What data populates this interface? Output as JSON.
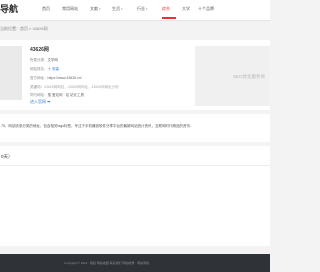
{
  "header": {
    "logo_text": "导航",
    "nav": [
      {
        "label": "首页"
      },
      {
        "label": "常用网站"
      },
      {
        "label": "文献"
      },
      {
        "label": "生活"
      },
      {
        "label": "行业"
      },
      {
        "label": "综合"
      },
      {
        "label": "大学"
      },
      {
        "label": "十个品牌"
      }
    ],
    "active_index": 4
  },
  "breadcrumb": "当前位置：首页 » 43626网",
  "site": {
    "name": "43626网",
    "rows": [
      {
        "label": "所属分类：",
        "value": "文学网"
      },
      {
        "label": "网站排名：",
        "value": "十 安装"
      },
      {
        "label": "官方网址：",
        "value": "https://www.43626.cn/"
      },
      {
        "label": "关键词：",
        "value": "43626网网站，43626网网址，43626网网址分析"
      },
      {
        "label": "同行网站：",
        "value": "搜 爱站网  ·  站 站长工具"
      }
    ],
    "enter_label": "进入官网 ➡"
  },
  "ad": {
    "text": "SEO优化服务商"
  },
  "description": "75，网站收录分类的地址，包含相关tags标签，专注于手机赚钱软件分享平台的最新网站统计资讯，互联网时代精品的资讯..",
  "panel": {
    "title": "0天）"
  },
  "footer": {
    "text": "Copyright © 2021 · 版权   网站地图   联系我们   网站收录 · 网站导航"
  }
}
